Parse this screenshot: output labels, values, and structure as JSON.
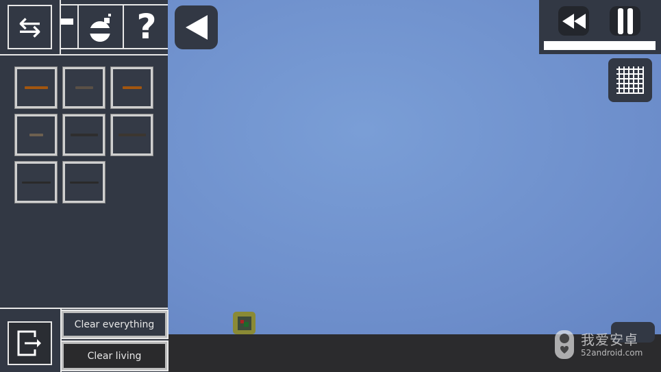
{
  "toolbar": {
    "icons": [
      "swap-arrows-icon",
      "partial-arrow-icon",
      "bomb-icon",
      "help-icon"
    ],
    "back_icon": "back-triangle-icon"
  },
  "inventory": {
    "items": [
      "pistol",
      "submachine-gun",
      "flare-gun",
      "small-rifle",
      "shotgun",
      "assault-rifle",
      "sniper-rifle",
      "long-rifle"
    ]
  },
  "bottom": {
    "exit_icon": "exit-door-icon",
    "clear_everything": "Clear everything",
    "clear_living": "Clear living"
  },
  "controls": {
    "rewind_icon": "rewind-icon",
    "pause_icon": "pause-icon",
    "grid_icon": "grid-icon",
    "time_progress": 1.0
  },
  "watermark": {
    "title": "我爱安卓",
    "site": "52android.com"
  },
  "colors": {
    "panel": "#323844",
    "sky": "#6f8fcb",
    "ground": "#2b2b2d"
  }
}
